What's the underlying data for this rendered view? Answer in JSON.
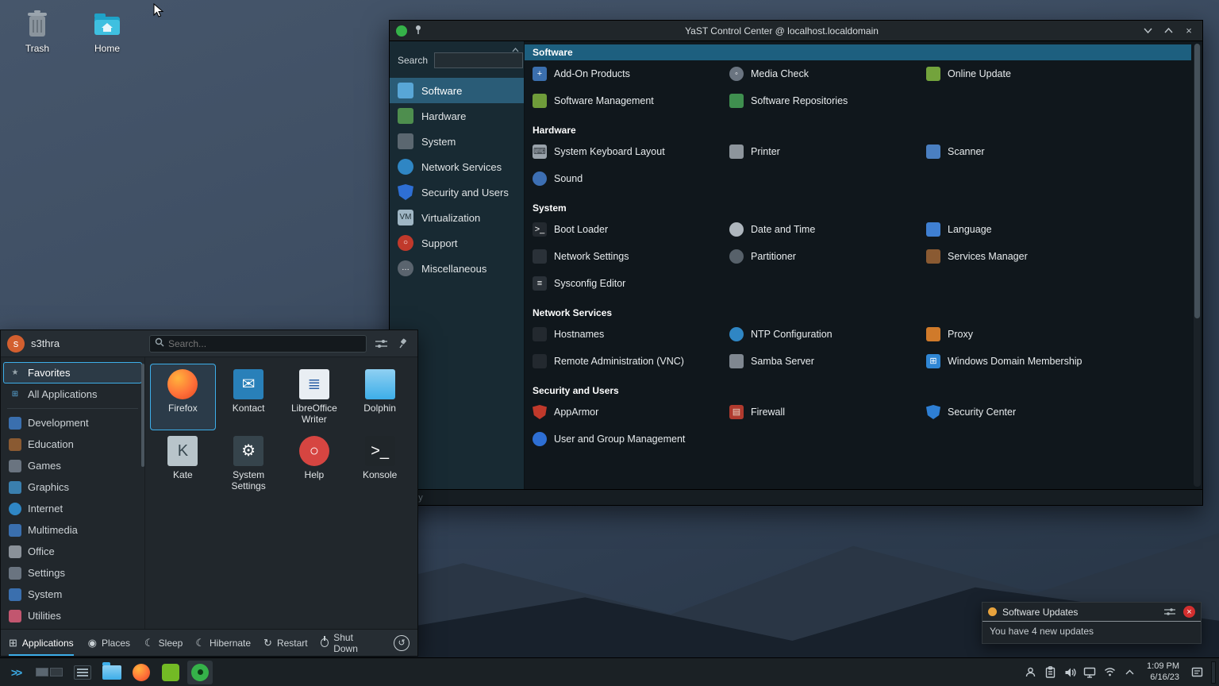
{
  "desktop": {
    "icons": [
      {
        "label": "Trash"
      },
      {
        "label": "Home"
      }
    ]
  },
  "yast": {
    "title": "YaST Control Center @ localhost.localdomain",
    "search_label": "Search",
    "status": "Ready",
    "accent": "#3daee9",
    "header_highlight": "#1d5f7f",
    "sidebar": [
      {
        "label": "Software",
        "sel": true,
        "ic": {
          "bg": "#58a6d6"
        }
      },
      {
        "label": "Hardware",
        "ic": {
          "bg": "#4e8e4e"
        }
      },
      {
        "label": "System",
        "ic": {
          "bg": "#5b6770"
        }
      },
      {
        "label": "Network Services",
        "ic": {
          "bg": "#2f86c4",
          "sh": "circle"
        }
      },
      {
        "label": "Security and Users",
        "ic": {
          "bg": "#2e6fd4",
          "sh": "shield"
        }
      },
      {
        "label": "Virtualization",
        "ic": {
          "bg": "#9fb6c4",
          "g": "VM",
          "fg": "#223238"
        }
      },
      {
        "label": "Support",
        "ic": {
          "bg": "#c0392b",
          "sh": "circle",
          "g": "○"
        }
      },
      {
        "label": "Miscellaneous",
        "ic": {
          "bg": "#5a646e",
          "sh": "circle",
          "g": "…"
        }
      }
    ],
    "groups": [
      {
        "title": "Software",
        "hl": true,
        "items": [
          {
            "label": "Add-On Products",
            "ic": {
              "bg": "#3b6fae",
              "g": "+"
            }
          },
          {
            "label": "Media Check",
            "ic": {
              "bg": "#6a7480",
              "sh": "circle",
              "g": "◦"
            }
          },
          {
            "label": "Online Update",
            "ic": {
              "bg": "#73a33c"
            }
          },
          {
            "label": "Software Management",
            "ic": {
              "bg": "#6f9c3a"
            }
          },
          {
            "label": "Software Repositories",
            "ic": {
              "bg": "#3f8f4f"
            }
          }
        ]
      },
      {
        "title": "Hardware",
        "items": [
          {
            "label": "System Keyboard Layout",
            "ic": {
              "bg": "#9aa3ab",
              "g": "⌨",
              "fg": "#333a40"
            }
          },
          {
            "label": "Printer",
            "ic": {
              "bg": "#8d959c"
            }
          },
          {
            "label": "Scanner",
            "ic": {
              "bg": "#4a7fc1"
            }
          },
          {
            "label": "Sound",
            "ic": {
              "bg": "#3d6fb3",
              "sh": "circle"
            }
          }
        ]
      },
      {
        "title": "System",
        "items": [
          {
            "label": "Boot Loader",
            "ic": {
              "bg": "#23292f",
              "g": ">_"
            }
          },
          {
            "label": "Date and Time",
            "ic": {
              "bg": "#aeb6bd",
              "sh": "circle"
            }
          },
          {
            "label": "Language",
            "ic": {
              "bg": "#3f7fd1"
            }
          },
          {
            "label": "Network Settings",
            "ic": {
              "bg": "#2a3138"
            }
          },
          {
            "label": "Partitioner",
            "ic": {
              "bg": "#57616a",
              "sh": "circle"
            }
          },
          {
            "label": "Services Manager",
            "ic": {
              "bg": "#8a5a32"
            }
          },
          {
            "label": "Sysconfig Editor",
            "ic": {
              "bg": "#2a3138",
              "g": "≡"
            }
          }
        ]
      },
      {
        "title": "Network Services",
        "items": [
          {
            "label": "Hostnames",
            "ic": {
              "bg": "#23292f"
            }
          },
          {
            "label": "NTP Configuration",
            "ic": {
              "bg": "#2f86c4",
              "sh": "circle"
            }
          },
          {
            "label": "Proxy",
            "ic": {
              "bg": "#d07a2a"
            }
          },
          {
            "label": "Remote Administration (VNC)",
            "ic": {
              "bg": "#23292f"
            }
          },
          {
            "label": "Samba Server",
            "ic": {
              "bg": "#7f8790"
            }
          },
          {
            "label": "Windows Domain Membership",
            "ic": {
              "bg": "#2f86d4",
              "g": "⊞"
            }
          }
        ]
      },
      {
        "title": "Security and Users",
        "items": [
          {
            "label": "AppArmor",
            "ic": {
              "bg": "#c0392b",
              "sh": "shield"
            }
          },
          {
            "label": "Firewall",
            "ic": {
              "bg": "#b03a2e",
              "g": "▤",
              "fg": "#e8d8c8"
            }
          },
          {
            "label": "Security Center",
            "ic": {
              "bg": "#2e7fd4",
              "sh": "shield"
            }
          },
          {
            "label": "User and Group Management",
            "ic": {
              "bg": "#2e6fd4",
              "sh": "circle"
            }
          }
        ]
      }
    ]
  },
  "launcher": {
    "user": "s3thra",
    "avatar": "s",
    "search_placeholder": "Search...",
    "categories": [
      {
        "label": "Favorites",
        "sel": true,
        "ic": {
          "bg": "none",
          "g": "★",
          "fg": "#9aa7ae"
        }
      },
      {
        "label": "All Applications",
        "sep": true,
        "ic": {
          "bg": "none",
          "g": "⊞",
          "fg": "#58a6d6"
        }
      },
      {
        "label": "Development",
        "ic": {
          "bg": "#3a6fae"
        }
      },
      {
        "label": "Education",
        "ic": {
          "bg": "#8a5a32"
        }
      },
      {
        "label": "Games",
        "ic": {
          "bg": "#6a7480"
        }
      },
      {
        "label": "Graphics",
        "ic": {
          "bg": "#3a7fae"
        }
      },
      {
        "label": "Internet",
        "ic": {
          "bg": "#2f86c4",
          "sh": "circle"
        }
      },
      {
        "label": "Multimedia",
        "ic": {
          "bg": "#3a6fae"
        }
      },
      {
        "label": "Office",
        "ic": {
          "bg": "#8a9199"
        }
      },
      {
        "label": "Settings",
        "ic": {
          "bg": "#6a7480"
        }
      },
      {
        "label": "System",
        "ic": {
          "bg": "#3a6fae"
        }
      },
      {
        "label": "Utilities",
        "ic": {
          "bg": "#c2566f"
        }
      }
    ],
    "apps": [
      {
        "label": "Firefox",
        "sel": true,
        "ic": {
          "bg": "radial-gradient(circle at 35% 30%,#ffb43c,#ff7139 55%,#e3461f)",
          "sh": "circle"
        }
      },
      {
        "label": "Kontact",
        "ic": {
          "bg": "#2980b9",
          "g": "✉"
        }
      },
      {
        "label": "LibreOffice Writer",
        "ic": {
          "bg": "#e9eef3",
          "g": "≣",
          "fg": "#2a5fa5"
        }
      },
      {
        "label": "Dolphin",
        "ic": {
          "bg": "linear-gradient(180deg,#8fd0f2,#3daee9)"
        }
      },
      {
        "label": "Kate",
        "ic": {
          "bg": "#b8c4ca",
          "g": "K",
          "fg": "#37474f"
        }
      },
      {
        "label": "System Settings",
        "ic": {
          "bg": "#36444c",
          "g": "⚙"
        }
      },
      {
        "label": "Help",
        "ic": {
          "bg": "#d64541",
          "sh": "circle",
          "g": "○",
          "fg": "#ffffff"
        }
      },
      {
        "label": "Konsole",
        "ic": {
          "bg": "#20262a",
          "g": ">_"
        }
      }
    ],
    "footer": {
      "tabs": [
        {
          "label": "Applications",
          "sel": true,
          "g": "⊞"
        },
        {
          "label": "Places",
          "g": "◉"
        }
      ],
      "actions": [
        {
          "label": "Sleep",
          "g": "☾"
        },
        {
          "label": "Hibernate",
          "g": "☾"
        },
        {
          "label": "Restart",
          "g": "↻"
        },
        {
          "label": "Shut Down",
          "g": "power"
        }
      ]
    }
  },
  "notification": {
    "title": "Software Updates",
    "body": "You have 4 new updates"
  },
  "taskbar": {
    "time": "1:09 PM",
    "date": "6/16/23"
  }
}
